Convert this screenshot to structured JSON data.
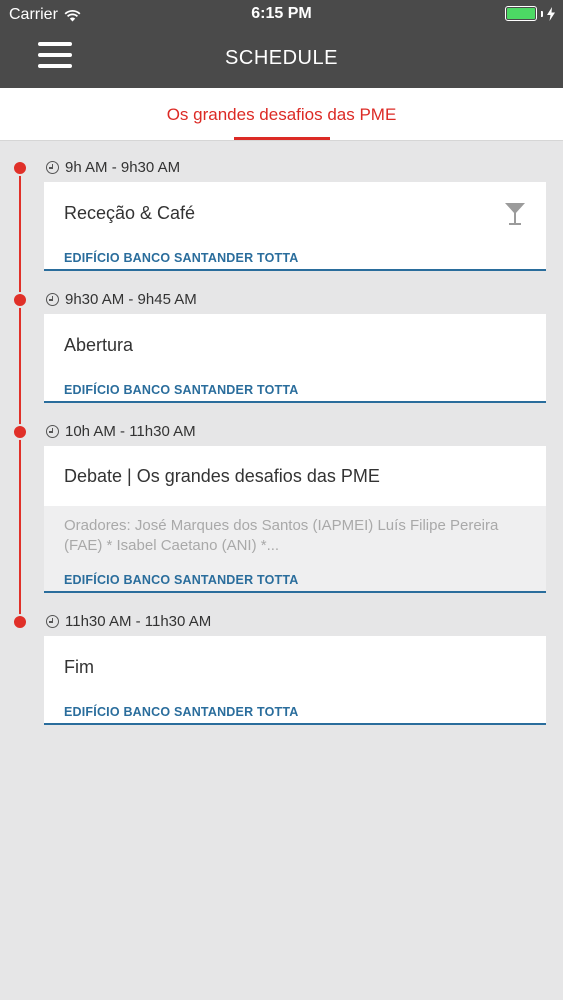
{
  "status_bar": {
    "carrier": "Carrier",
    "time": "6:15 PM"
  },
  "header": {
    "title": "SCHEDULE"
  },
  "subheader": {
    "title": "Os grandes desafios das PME"
  },
  "colors": {
    "accent": "#dc2a25",
    "location": "#2a6d9c",
    "header_bg": "#4a4a4a",
    "battery": "#4cd964"
  },
  "sessions": [
    {
      "time": "9h AM - 9h30 AM",
      "title": "Receção & Café",
      "location": "EDIFÍCIO BANCO SANTANDER TOTTA",
      "icon": "cocktail-icon"
    },
    {
      "time": "9h30 AM - 9h45 AM",
      "title": "Abertura",
      "location": "EDIFÍCIO BANCO SANTANDER TOTTA"
    },
    {
      "time": "10h AM - 11h30 AM",
      "title": "Debate | Os grandes desafios das PME",
      "description": "Oradores: José Marques dos Santos (IAPMEI) Luís Filipe Pereira (FAE) * Isabel Caetano (ANI) *...",
      "location": "EDIFÍCIO BANCO SANTANDER TOTTA"
    },
    {
      "time": "11h30 AM - 11h30 AM",
      "title": "Fim",
      "location": "EDIFÍCIO BANCO SANTANDER TOTTA"
    }
  ]
}
